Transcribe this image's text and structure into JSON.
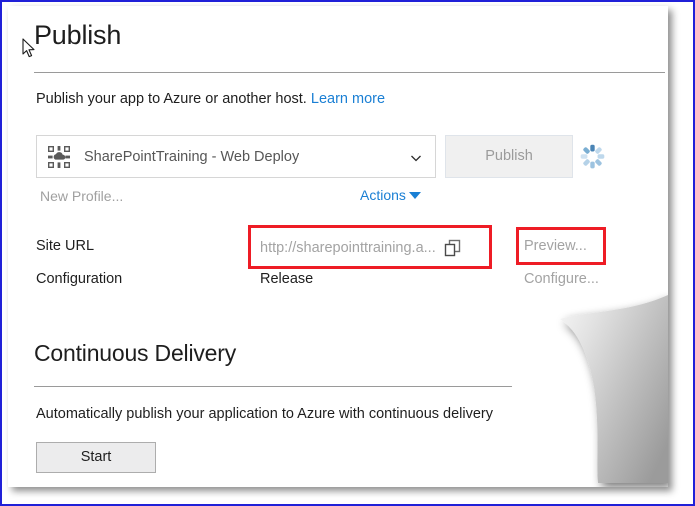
{
  "window": {
    "border_color": "#2020d8",
    "card_background": "#ffffff"
  },
  "publish_section": {
    "title": "Publish",
    "subtitle_text": "Publish your app to Azure or another host.",
    "learn_more_label": "Learn more",
    "learn_more_color": "#1a7fd4",
    "profile": {
      "icon": "web-deploy-icon",
      "selected_value": "SharePointTraining - Web Deploy",
      "chevron_icon": "chevron-down-icon"
    },
    "publish_button": {
      "label": "Publish",
      "state": "disabled",
      "text_color": "#9b9b9b",
      "background": "#f0f0f0"
    },
    "spinner": {
      "icon": "loading-spinner-icon",
      "color": "#9dc3e0"
    },
    "new_profile_label": "New Profile...",
    "actions_label": "Actions",
    "actions_caret_icon": "caret-down-icon",
    "details": [
      {
        "label": "Site URL",
        "value": "http://sharepointtraining.a...",
        "action": "Preview..."
      },
      {
        "label": "Configuration",
        "value": "Release",
        "action": "Configure..."
      }
    ],
    "copy_icon": "copy-icon",
    "highlight_color": "#ee1c25"
  },
  "continuous_delivery_section": {
    "title": "Continuous Delivery",
    "description": "Automatically publish your application to Azure with continuous delivery",
    "start_button_label": "Start"
  },
  "cursor": {
    "icon": "mouse-pointer-icon"
  }
}
